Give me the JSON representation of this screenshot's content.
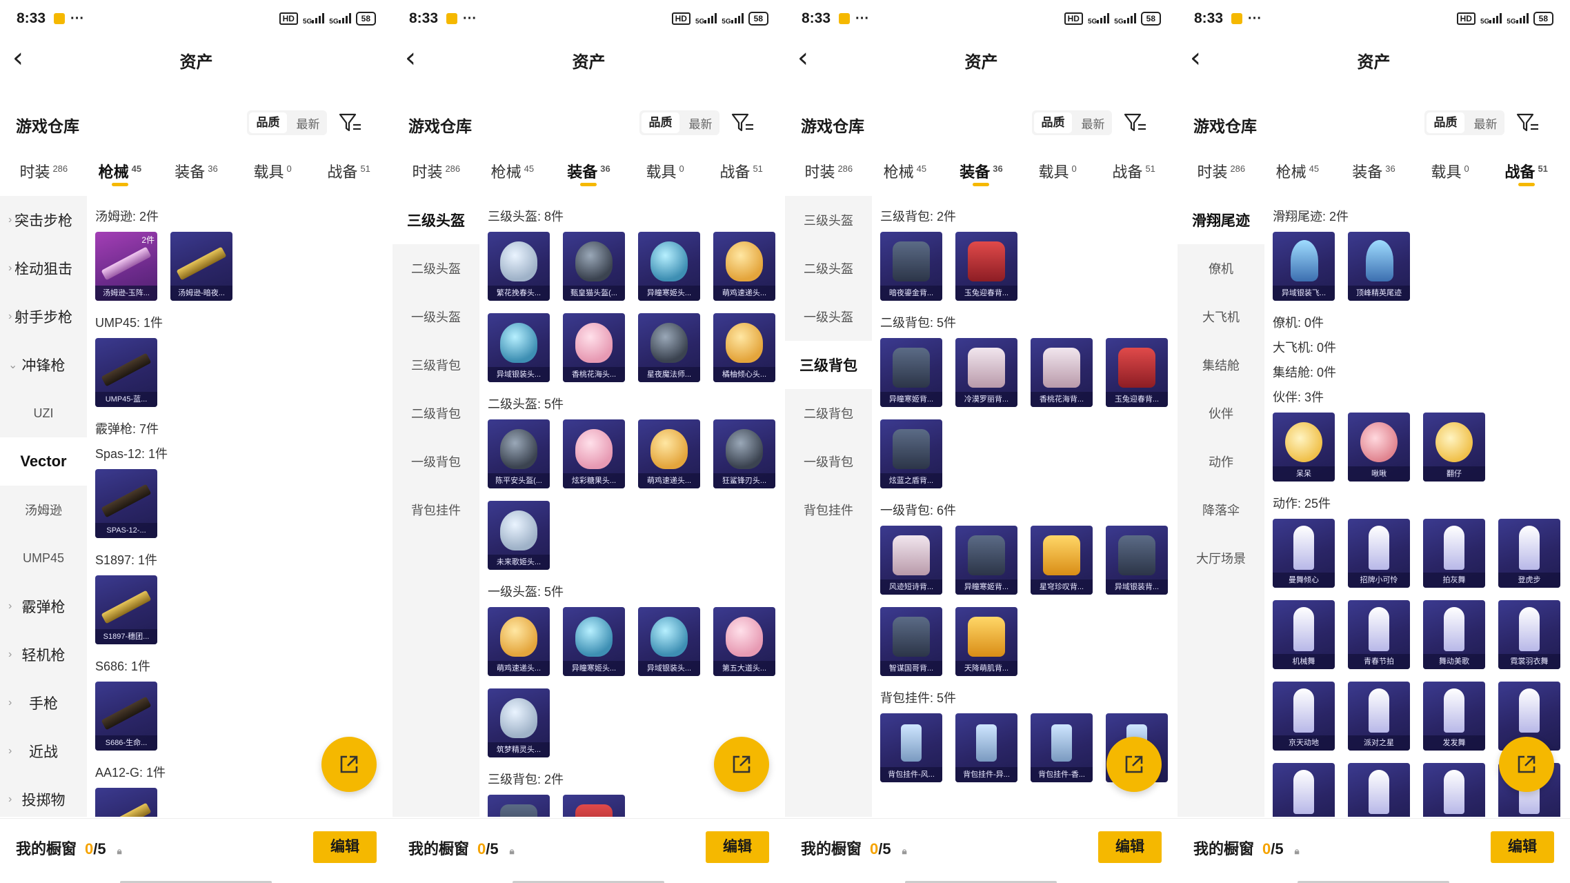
{
  "status": {
    "time": "8:33",
    "hd": "HD",
    "sig1": "5G",
    "sig2": "5G",
    "battery": "58"
  },
  "header": {
    "title": "资产",
    "back_icon": "chevron-left-icon"
  },
  "warehouse": {
    "title": "游戏仓库",
    "sort_quality": "品质",
    "sort_latest": "最新",
    "filter_icon": "filter-icon"
  },
  "tabs": [
    {
      "label": "时装",
      "count": "286"
    },
    {
      "label": "枪械",
      "count": "45"
    },
    {
      "label": "装备",
      "count": "36"
    },
    {
      "label": "载具",
      "count": "0"
    },
    {
      "label": "战备",
      "count": "51"
    }
  ],
  "footer": {
    "label": "我的橱窗",
    "count": "0",
    "total": "/5",
    "edit": "编辑"
  },
  "panels": [
    {
      "active_tab": 1,
      "side": [
        {
          "label": "突击步枪",
          "type": "lvl"
        },
        {
          "label": "栓动狙击",
          "type": "lvl"
        },
        {
          "label": "射手步枪",
          "type": "lvl"
        },
        {
          "label": "冲锋枪",
          "type": "lvl-open"
        },
        {
          "label": "UZI",
          "type": "sub"
        },
        {
          "label": "Vector",
          "type": "sub-sel"
        },
        {
          "label": "汤姆逊",
          "type": "sub"
        },
        {
          "label": "UMP45",
          "type": "sub"
        },
        {
          "label": "霰弹枪",
          "type": "lvl"
        },
        {
          "label": "轻机枪",
          "type": "lvl"
        },
        {
          "label": "手枪",
          "type": "lvl"
        },
        {
          "label": "近战",
          "type": "lvl"
        },
        {
          "label": "投掷物",
          "type": "lvl"
        }
      ],
      "sections": [
        {
          "title": "汤姆逊: 2件",
          "items": [
            {
              "name": "汤姆逊-玉阵...",
              "art": "gun p",
              "tone": "g",
              "cnt": "2件"
            },
            {
              "name": "汤姆逊-暗夜...",
              "art": "gun y"
            }
          ]
        },
        {
          "title": "UMP45: 1件",
          "items": [
            {
              "name": "UMP45-蓝...",
              "art": "gun"
            }
          ]
        },
        {
          "title": "霰弹枪: 7件",
          "items": []
        },
        {
          "title": "Spas-12: 1件",
          "items": [
            {
              "name": "SPAS-12-...",
              "art": "gun"
            }
          ]
        },
        {
          "title": "S1897: 1件",
          "items": [
            {
              "name": "S1897-穗团...",
              "art": "gun y"
            }
          ]
        },
        {
          "title": "S686: 1件",
          "items": [
            {
              "name": "S686-生命...",
              "art": "gun"
            }
          ]
        },
        {
          "title": "AA12-G: 1件",
          "items": [
            {
              "name": "",
              "art": "gun y"
            }
          ]
        }
      ]
    },
    {
      "active_tab": 2,
      "side": [
        {
          "label": "三级头盔",
          "type": "sel"
        },
        {
          "label": "二级头盔",
          "type": "n"
        },
        {
          "label": "一级头盔",
          "type": "n"
        },
        {
          "label": "三级背包",
          "type": "n"
        },
        {
          "label": "二级背包",
          "type": "n"
        },
        {
          "label": "一级背包",
          "type": "n"
        },
        {
          "label": "背包挂件",
          "type": "n"
        }
      ],
      "sections": [
        {
          "title": "三级头盔: 8件",
          "items": [
            {
              "name": "繁花挽春头...",
              "art": "hel"
            },
            {
              "name": "甄皇猫头盔(...",
              "art": "hel d"
            },
            {
              "name": "异瞳寒姬头...",
              "art": "hel t"
            },
            {
              "name": "萌鸡速递头...",
              "art": "hel y"
            },
            {
              "name": "异域银装头...",
              "art": "hel t"
            },
            {
              "name": "香桃花海头...",
              "art": "hel p"
            },
            {
              "name": "星夜魔法师...",
              "art": "hel d"
            },
            {
              "name": "橘柚倾心头...",
              "art": "hel y"
            }
          ]
        },
        {
          "title": "二级头盔: 5件",
          "items": [
            {
              "name": "陈平安头盔(...",
              "art": "hel d"
            },
            {
              "name": "炫彩糖果头...",
              "art": "hel p"
            },
            {
              "name": "萌鸡速递头...",
              "art": "hel y"
            },
            {
              "name": "狂鲨锋刃头...",
              "art": "hel d"
            },
            {
              "name": "未来歌姬头...",
              "art": "hel"
            }
          ]
        },
        {
          "title": "一级头盔: 5件",
          "items": [
            {
              "name": "萌鸡速递头...",
              "art": "hel y"
            },
            {
              "name": "异瞳寒姬头...",
              "art": "hel t"
            },
            {
              "name": "异域银装头...",
              "art": "hel t"
            },
            {
              "name": "第五大道头...",
              "art": "hel p"
            },
            {
              "name": "筑梦精灵头...",
              "art": "hel"
            }
          ]
        },
        {
          "title": "三级背包: 2件",
          "items": [
            {
              "name": "",
              "art": "bag"
            },
            {
              "name": "",
              "art": "bag r"
            }
          ]
        }
      ]
    },
    {
      "active_tab": 2,
      "side": [
        {
          "label": "三级头盔",
          "type": "n"
        },
        {
          "label": "二级头盔",
          "type": "n"
        },
        {
          "label": "一级头盔",
          "type": "n"
        },
        {
          "label": "三级背包",
          "type": "sel"
        },
        {
          "label": "二级背包",
          "type": "n"
        },
        {
          "label": "一级背包",
          "type": "n"
        },
        {
          "label": "背包挂件",
          "type": "n"
        }
      ],
      "sections": [
        {
          "title": "三级背包: 2件",
          "items": [
            {
              "name": "暗夜鎏金背...",
              "art": "bag"
            },
            {
              "name": "玉兔迎春背...",
              "art": "bag r"
            }
          ]
        },
        {
          "title": "二级背包: 5件",
          "items": [
            {
              "name": "异瞳寒姬背...",
              "art": "bag"
            },
            {
              "name": "冷漠罗丽背...",
              "art": "bag w"
            },
            {
              "name": "香桃花海背...",
              "art": "bag w"
            },
            {
              "name": "玉兔迎春背...",
              "art": "bag r"
            },
            {
              "name": "炫蓝之盾背...",
              "art": "bag"
            }
          ]
        },
        {
          "title": "一级背包: 6件",
          "items": [
            {
              "name": "风迹短诗背...",
              "art": "bag w"
            },
            {
              "name": "异瞳寒姬背...",
              "art": "bag"
            },
            {
              "name": "星穹珍叹背...",
              "art": "bag y"
            },
            {
              "name": "异域银装背...",
              "art": "bag"
            },
            {
              "name": "智谋国哥背...",
              "art": "bag"
            },
            {
              "name": "天降萌肌背...",
              "art": "bag y"
            }
          ]
        },
        {
          "title": "背包挂件: 5件",
          "items": [
            {
              "name": "背包挂件-风...",
              "art": "pend"
            },
            {
              "name": "背包挂件-异...",
              "art": "pend"
            },
            {
              "name": "背包挂件-香...",
              "art": "pend"
            },
            {
              "name": "",
              "art": "pend"
            }
          ]
        }
      ]
    },
    {
      "active_tab": 4,
      "side": [
        {
          "label": "滑翔尾迹",
          "type": "sel"
        },
        {
          "label": "僚机",
          "type": "n"
        },
        {
          "label": "大飞机",
          "type": "n"
        },
        {
          "label": "集结舱",
          "type": "n"
        },
        {
          "label": "伙伴",
          "type": "n"
        },
        {
          "label": "动作",
          "type": "n"
        },
        {
          "label": "降落伞",
          "type": "n"
        },
        {
          "label": "大厅场景",
          "type": "n"
        }
      ],
      "sections": [
        {
          "title": "滑翔尾迹: 2件",
          "items": [
            {
              "name": "异域银装飞...",
              "art": "trail"
            },
            {
              "name": "顶峰精英尾迹",
              "art": "trail"
            }
          ]
        },
        {
          "title": "僚机: 0件",
          "items": []
        },
        {
          "title": "大飞机: 0件",
          "items": []
        },
        {
          "title": "集结舱: 0件",
          "items": []
        },
        {
          "title": "伙伴: 3件",
          "items": [
            {
              "name": "呆呆",
              "art": "pet"
            },
            {
              "name": "啾啾",
              "art": "pet p"
            },
            {
              "name": "翻仔",
              "art": "pet"
            }
          ]
        },
        {
          "title": "动作: 25件",
          "items": [
            {
              "name": "曼舞倾心",
              "art": "dance"
            },
            {
              "name": "招牌小可怜",
              "art": "dance"
            },
            {
              "name": "拍灰舞",
              "art": "dance"
            },
            {
              "name": "登虎步",
              "art": "dance"
            },
            {
              "name": "机械舞",
              "art": "dance"
            },
            {
              "name": "青春节拍",
              "art": "dance"
            },
            {
              "name": "舞动美歌",
              "art": "dance"
            },
            {
              "name": "霓裳羽衣舞",
              "art": "dance"
            },
            {
              "name": "京天动地",
              "art": "dance"
            },
            {
              "name": "派对之星",
              "art": "dance"
            },
            {
              "name": "发发舞",
              "art": "dance"
            },
            {
              "name": "",
              "art": "dance"
            },
            {
              "name": "",
              "art": "dance"
            },
            {
              "name": "",
              "art": "dance"
            },
            {
              "name": "",
              "art": "dance"
            },
            {
              "name": "",
              "art": "dance"
            }
          ]
        }
      ]
    }
  ]
}
